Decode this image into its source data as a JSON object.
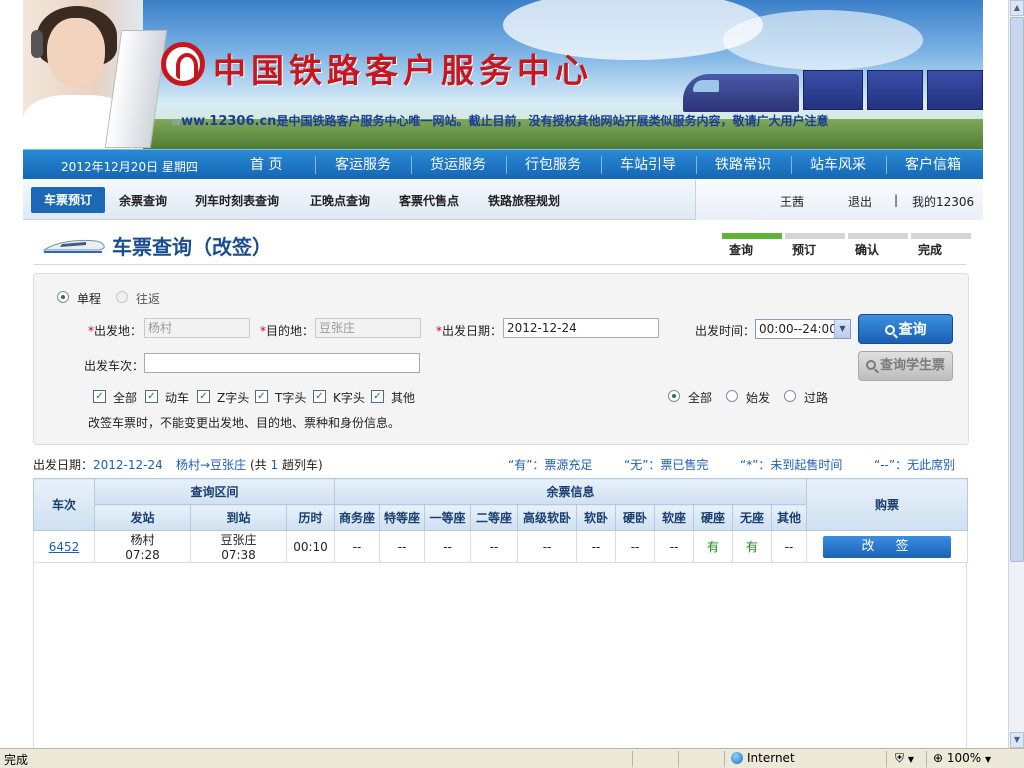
{
  "banner": {
    "brand": "中国铁路客户服务中心",
    "notice_prefix": "w",
    "notice_url": "ww.12306.cn",
    "notice_text": "是中国铁路客户服务中心唯一网站。截止目前，没有授权其他网站开展类似服务内容，敬请广大用户注意"
  },
  "mainnav": {
    "date": "2012年12月20日 星期四",
    "items": [
      "首  页",
      "客运服务",
      "货运服务",
      "行包服务",
      "车站引导",
      "铁路常识",
      "站车风采",
      "客户信箱"
    ]
  },
  "subnav": {
    "active": "车票预订",
    "items": [
      "余票查询",
      "列车时刻表查询",
      "正晚点查询",
      "客票代售点",
      "铁路旅程规划"
    ],
    "user": "王茜",
    "logout": "退出",
    "divider": "|",
    "my": "我的12306"
  },
  "page": {
    "title": "车票查询（改签）",
    "steps": [
      "查询",
      "预订",
      "确认",
      "完成"
    ]
  },
  "query": {
    "trip_one_way": "单程",
    "trip_round": "往返",
    "req_mark": "*",
    "from_label": "出发地：",
    "from_value": "杨村",
    "to_label": "目的地：",
    "to_value": "豆张庄",
    "date_label": "出发日期：",
    "date_value": "2012-12-24",
    "time_label": "出发时间：",
    "time_value": "00:00--24:00",
    "train_label": "出发车次：",
    "train_value": "",
    "search_button": "查询",
    "student_button": "查询学生票",
    "types": [
      "全部",
      "动车",
      "Z字头",
      "T字头",
      "K字头",
      "其他"
    ],
    "station_filters": [
      "全部",
      "始发",
      "过路"
    ],
    "note": "改签车票时，不能变更出发地、目的地、票种和身份信息。"
  },
  "info": {
    "date_label": "出发日期：",
    "date": "2012-12-24",
    "route": "杨村→豆张庄",
    "count_prefix": "(共",
    "count": "1",
    "count_suffix": "趟列车)",
    "legend_have": "“有”：票源充足",
    "legend_none": "“无”：票已售完",
    "legend_star": "“*”：未到起售时间",
    "legend_dash": "“--”：无此席别"
  },
  "table": {
    "h_train": "车次",
    "h_range": "查询区间",
    "h_remain": "余票信息",
    "h_buy": "购票",
    "sub_headers": [
      "发站",
      "到站",
      "历时",
      "商务座",
      "特等座",
      "一等座",
      "二等座",
      "高级软卧",
      "软卧",
      "硬卧",
      "软座",
      "硬座",
      "无座",
      "其他"
    ],
    "rows": [
      {
        "train": "6452",
        "from": "杨村",
        "from_time": "07:28",
        "to": "豆张庄",
        "to_time": "07:38",
        "duration": "00:10",
        "seats": [
          "--",
          "--",
          "--",
          "--",
          "--",
          "--",
          "--",
          "--",
          "有",
          "有",
          "--"
        ],
        "action": "改　签"
      }
    ]
  },
  "statusbar": {
    "done": "完成",
    "zone": "Internet",
    "zoom": "100%"
  }
}
